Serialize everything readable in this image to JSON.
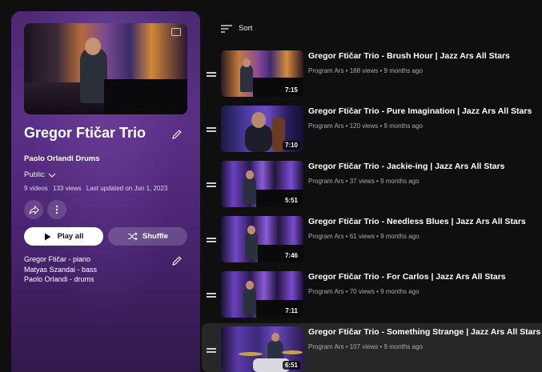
{
  "playlist": {
    "title": "Gregor Ftičar Trio",
    "owner": "Paolo Orlandi Drums",
    "privacy": "Public",
    "stats": {
      "videos": "9 videos",
      "views": "133 views",
      "updated": "Last updated on Jun 1, 2023"
    },
    "play_all_label": "Play all",
    "shuffle_label": "Shuffle",
    "description": [
      "Gregor Ftičar - piano",
      "Matyas Szandai - bass",
      "Paolo Orlandi - drums"
    ]
  },
  "sort_label": "Sort",
  "videos": [
    {
      "title": "Gregor Ftičar Trio - Brush Hour | Jazz Ars All Stars",
      "meta": "Program Ars • 188 views • 9 months ago",
      "duration": "7:15"
    },
    {
      "title": "Gregor Ftičar Trio - Pure Imagination | Jazz Ars All Stars",
      "meta": "Program Ars • 120 views • 9 months ago",
      "duration": "7:10"
    },
    {
      "title": "Gregor Ftičar Trio - Jackie-ing | Jazz Ars All Stars",
      "meta": "Program Ars • 37 views • 9 months ago",
      "duration": "5:51"
    },
    {
      "title": "Gregor Ftičar Trio - Needless Blues | Jazz Ars All Stars",
      "meta": "Program Ars • 61 views • 9 months ago",
      "duration": "7:46"
    },
    {
      "title": "Gregor Ftičar Trio - For Carlos | Jazz Ars All Stars",
      "meta": "Program Ars • 70 views • 9 months ago",
      "duration": "7:11"
    },
    {
      "title": "Gregor Ftičar Trio - Something Strange | Jazz Ars All Stars",
      "meta": "Program Ars • 107 views • 9 months ago",
      "duration": "6:51"
    }
  ],
  "colors": {
    "panel": "#4b2a72",
    "bg": "#0f0f0f",
    "highlight_row": "#272727"
  },
  "icons": [
    "edit-icon",
    "chevron-down-icon",
    "share-icon",
    "more-icon",
    "play-icon",
    "shuffle-icon",
    "sort-icon",
    "drag-handle-icon"
  ]
}
